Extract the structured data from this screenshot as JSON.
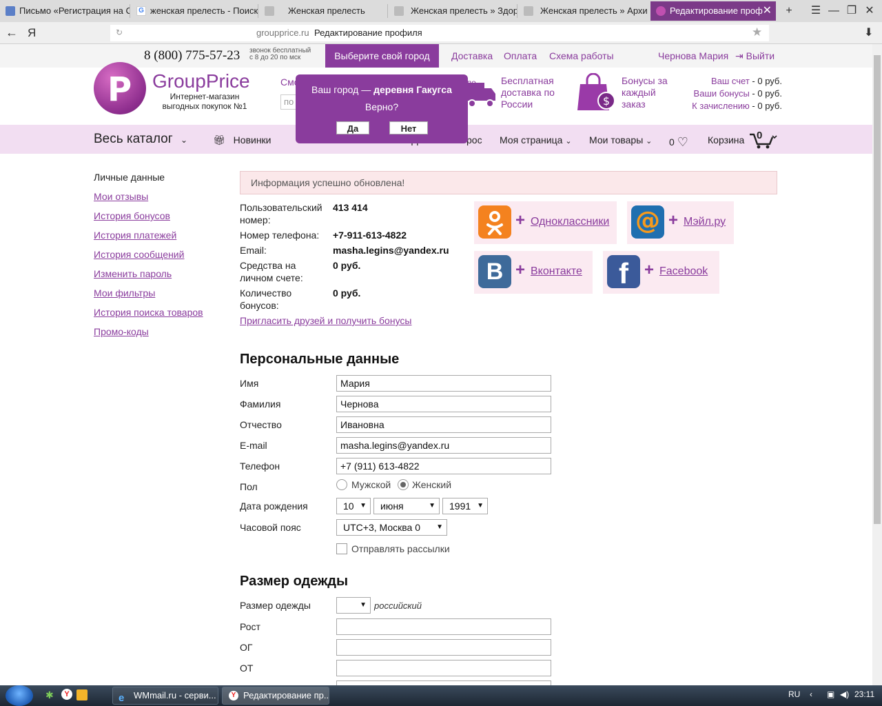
{
  "browser": {
    "tabs": [
      {
        "label": "Письмо «Регистрация на С",
        "icon": "mail-icon"
      },
      {
        "label": "женская прелесть - Поиск",
        "icon": "google-icon"
      },
      {
        "label": "Женская прелесть",
        "icon": "page-icon"
      },
      {
        "label": "Женская прелесть » Здоро",
        "icon": "page-icon"
      },
      {
        "label": "Женская прелесть » Архив",
        "icon": "page-icon"
      },
      {
        "label": "Редактирование проф",
        "icon": "groupprice-icon"
      }
    ],
    "new_tab": "+",
    "address": {
      "domain": "groupprice.ru",
      "title": "Редактирование профиля",
      "yandex_logo": "Я"
    }
  },
  "header": {
    "phone": "8 (800) 775-57-23",
    "phone_note_1": "звонок бесплатный",
    "phone_note_2": "с 8 до 20 по мск",
    "city_button": "Выберите свой город",
    "links": [
      "Доставка",
      "Оплата",
      "Схема работы"
    ],
    "user": "Чернова Мария",
    "logout": "Выйти",
    "brand": "GroupPrice",
    "brand_sub_1": "Интернет-магазин",
    "brand_sub_2": "выгодных покупок №1",
    "search_label": "Смо",
    "search_placeholder": "по",
    "delivery_badge": "ло",
    "features": [
      {
        "icon": "truck-icon",
        "lines": [
          "Бесплатная",
          "доставка по",
          "России"
        ]
      },
      {
        "icon": "shopping-bag-icon",
        "lines": [
          "Бонусы за",
          "каждый",
          "заказ"
        ]
      }
    ],
    "account": [
      {
        "label": "Ваш счет",
        "value": " - 0 руб."
      },
      {
        "label": "Ваши бонусы",
        "value": " - 0 руб."
      },
      {
        "label": "К зачислению",
        "value": " - 0 руб."
      }
    ]
  },
  "city_popup": {
    "question_prefix": "Ваш город — ",
    "city": "деревня Гакугса",
    "confirm": "Верно?",
    "yes": "Да",
    "no": "Нет"
  },
  "nav": {
    "catalog": "Весь каталог",
    "new": "Новинки",
    "partial_1": "Д",
    "partial_2": "рос",
    "my_page": "Моя страница",
    "my_goods": "Мои товары",
    "fav_count": "0",
    "cart": "Корзина",
    "cart_count": "0"
  },
  "sidebar": [
    {
      "label": "Личные данные",
      "current": true
    },
    {
      "label": "Мои отзывы"
    },
    {
      "label": "История бонусов"
    },
    {
      "label": "История платежей"
    },
    {
      "label": "История сообщений"
    },
    {
      "label": "Изменить пароль"
    },
    {
      "label": "Мои фильтры"
    },
    {
      "label": "История поиска товаров"
    },
    {
      "label": "Промо-коды"
    }
  ],
  "alert": "Информация успешно обновлена!",
  "info": {
    "user_number_label_1": "Пользовательский",
    "user_number_label_2": "номер:",
    "user_number": "413 414",
    "phone_label": "Номер телефона:",
    "phone": "+7-911-613-4822",
    "email_label": "Email:",
    "email": "masha.legins@yandex.ru",
    "funds_label_1": "Средства на",
    "funds_label_2": "личном счете:",
    "funds": "0 руб.",
    "bonus_label_1": "Количество",
    "bonus_label_2": "бонусов:",
    "bonus": "0 руб.",
    "invite": "Пригласить друзей и получить бонусы"
  },
  "social": [
    {
      "name": "Одноклассники",
      "icon": "odnoklassniki-icon",
      "color": "#f4821f",
      "glyph": "ok"
    },
    {
      "name": "Мэйл.ру",
      "icon": "mailru-icon",
      "color": "#1f6fb0",
      "glyph": "@"
    },
    {
      "name": "Вконтакте",
      "icon": "vkontakte-icon",
      "color": "#3e6a9a",
      "glyph": "B"
    },
    {
      "name": "Facebook",
      "icon": "facebook-icon",
      "color": "#3b5a9a",
      "glyph": "f"
    }
  ],
  "personal": {
    "title": "Персональные данные",
    "name_label": "Имя",
    "name": "Мария",
    "surname_label": "Фамилия",
    "surname": "Чернова",
    "patronymic_label": "Отчество",
    "patronymic": "Ивановна",
    "email_label": "E-mail",
    "email": "masha.legins@yandex.ru",
    "phone_label": "Телефон",
    "phone": "+7 (911) 613-4822",
    "gender_label": "Пол",
    "male": "Мужской",
    "female": "Женский",
    "dob_label": "Дата рождения",
    "dob_day": "10",
    "dob_month": "июня",
    "dob_year": "1991",
    "tz_label": "Часовой пояс",
    "tz": "UTC+3, Москва 0",
    "newsletter": "Отправлять рассылки"
  },
  "clothing": {
    "title": "Размер одежды",
    "size_label": "Размер одежды",
    "size_value": "",
    "size_note": "российский",
    "height_label": "Рост",
    "chest_label": "ОГ",
    "waist_label": "ОТ"
  },
  "taskbar": {
    "items": [
      {
        "label": "WMmail.ru - серви...",
        "icon": "ie-icon"
      },
      {
        "label": "Редактирование пр...",
        "icon": "yandex-browser-icon"
      }
    ],
    "lang": "RU",
    "time": "23:11"
  },
  "colors": {
    "accent": "#8a3c9d",
    "nav_bg": "#f2def2",
    "alert_bg": "#fbe8ea"
  }
}
